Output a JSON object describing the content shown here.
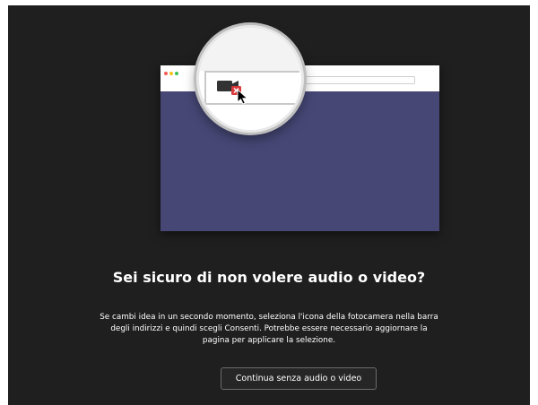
{
  "dialog": {
    "title": "Sei sicuro di non volere audio o video?",
    "description": "Se cambi idea in un secondo momento, seleziona l'icona della fotocamera nella barra degli indirizzi e quindi scegli Consenti. Potrebbe essere necessario aggiornare la pagina per applicare la selezione.",
    "continue_button_label": "Continua senza audio o video"
  },
  "colors": {
    "background": "#1f1f1f",
    "illustration_page": "#464775",
    "blocked_badge": "#d9393a",
    "text": "#ffffff"
  },
  "icons": {
    "browser_controls": "traffic-light-dots",
    "camera": "camera-blocked-icon",
    "cursor": "mouse-pointer-icon",
    "magnifier": "magnifier-circle"
  }
}
